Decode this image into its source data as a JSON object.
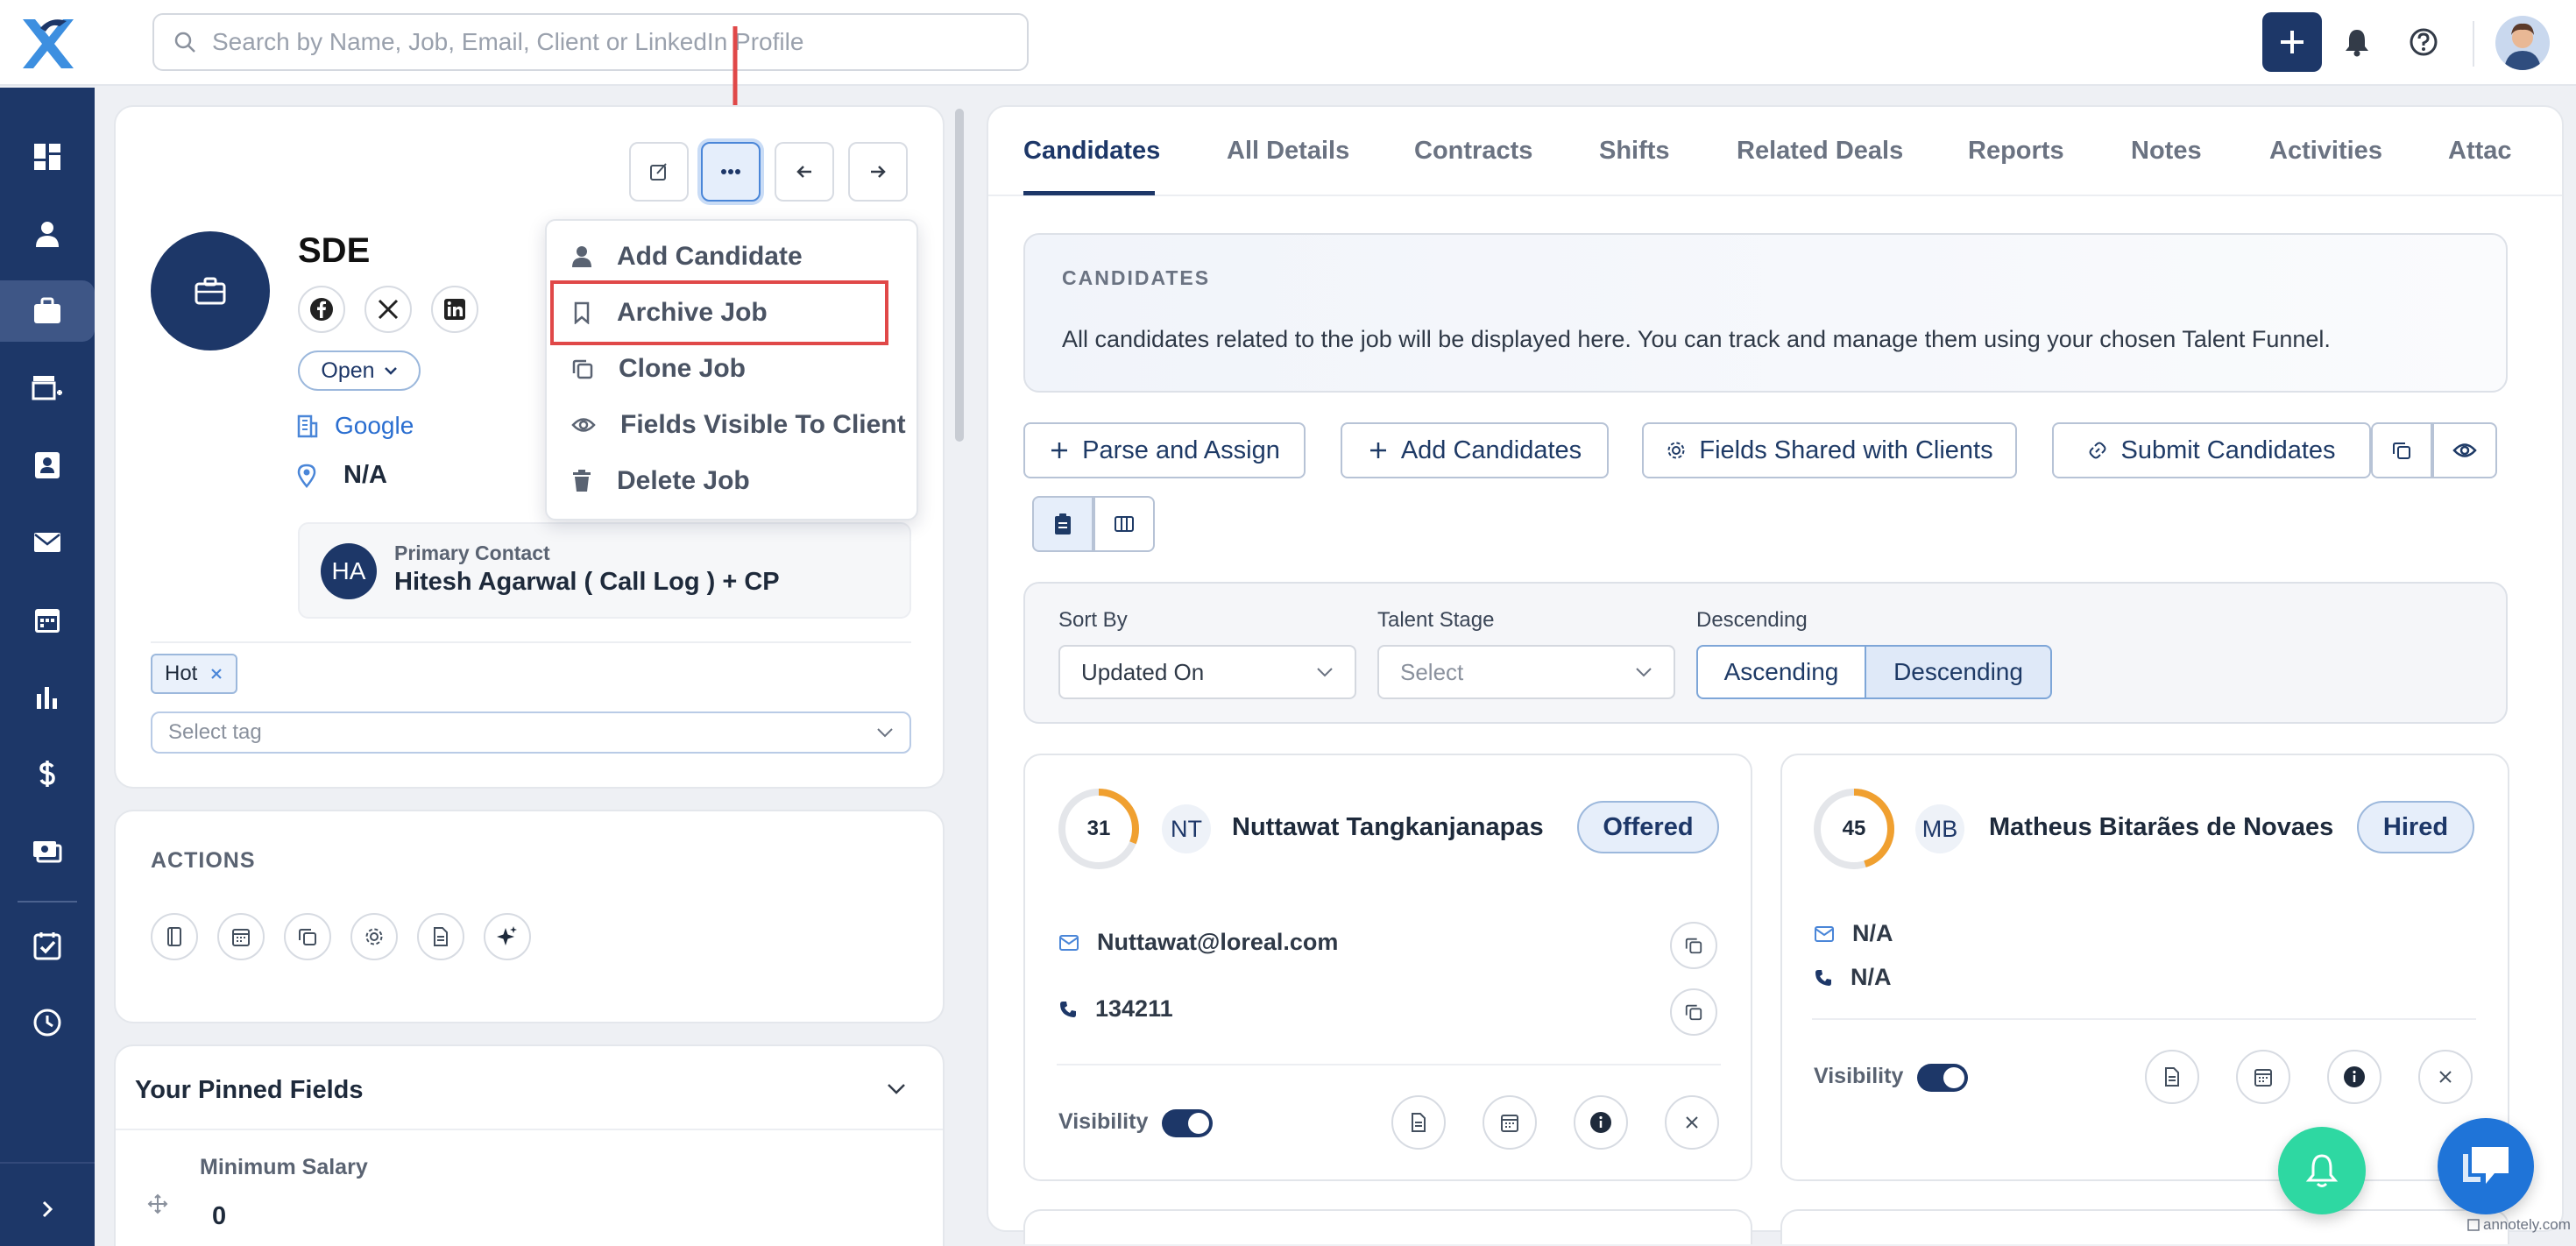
{
  "header": {
    "search_placeholder": "Search by Name, Job, Email, Client or LinkedIn Profile"
  },
  "job": {
    "avatar_icon": "briefcase-icon",
    "title": "SDE",
    "status": "Open",
    "client": "Google",
    "location": "N/A",
    "primary_contact": {
      "label": "Primary Contact",
      "initials": "HA",
      "name": "Hitesh Agarwal ( Call Log ) + CP"
    },
    "tags": [
      "Hot"
    ],
    "tag_placeholder": "Select tag"
  },
  "menu": {
    "items": [
      "Add Candidate",
      "Archive Job",
      "Clone Job",
      "Fields Visible To Client",
      "Delete Job"
    ],
    "highlighted": "Archive Job"
  },
  "actions": {
    "title": "ACTIONS"
  },
  "pinned": {
    "title": "Your Pinned Fields",
    "field_label": "Minimum Salary",
    "field_value": "0"
  },
  "tabs": [
    "Candidates",
    "All Details",
    "Contracts",
    "Shifts",
    "Related Deals",
    "Reports",
    "Notes",
    "Activities",
    "Attac"
  ],
  "active_tab": "Candidates",
  "candidates_info": {
    "title": "CANDIDATES",
    "description": "All candidates related to the job will be displayed here. You can track and manage them using your chosen Talent Funnel."
  },
  "buttons": {
    "parse": "Parse and Assign",
    "add": "Add Candidates",
    "fields_shared": "Fields Shared with Clients",
    "submit": "Submit Candidates"
  },
  "filters": {
    "sort_label": "Sort By",
    "sort_value": "Updated On",
    "stage_label": "Talent Stage",
    "stage_placeholder": "Select",
    "order_label": "Descending",
    "asc": "Ascending",
    "desc": "Descending",
    "selected": "Descending"
  },
  "candidates": [
    {
      "score": "31",
      "initials": "NT",
      "name": "Nuttawat Tangkanjanapas",
      "status": "Offered",
      "email": "Nuttawat@loreal.com",
      "phone": "134211",
      "visibility_label": "Visibility"
    },
    {
      "score": "45",
      "initials": "MB",
      "name": "Matheus Bitarães de Novaes",
      "status": "Hired",
      "email": "N/A",
      "phone": "N/A",
      "visibility_label": "Visibility"
    }
  ],
  "watermark": "annotely.com",
  "colors": {
    "primary": "#1d3768",
    "accent_orange": "#f0a030",
    "highlight_red": "#e04848",
    "fab_green": "#2ed8a2",
    "chat_blue": "#1f74d8"
  }
}
